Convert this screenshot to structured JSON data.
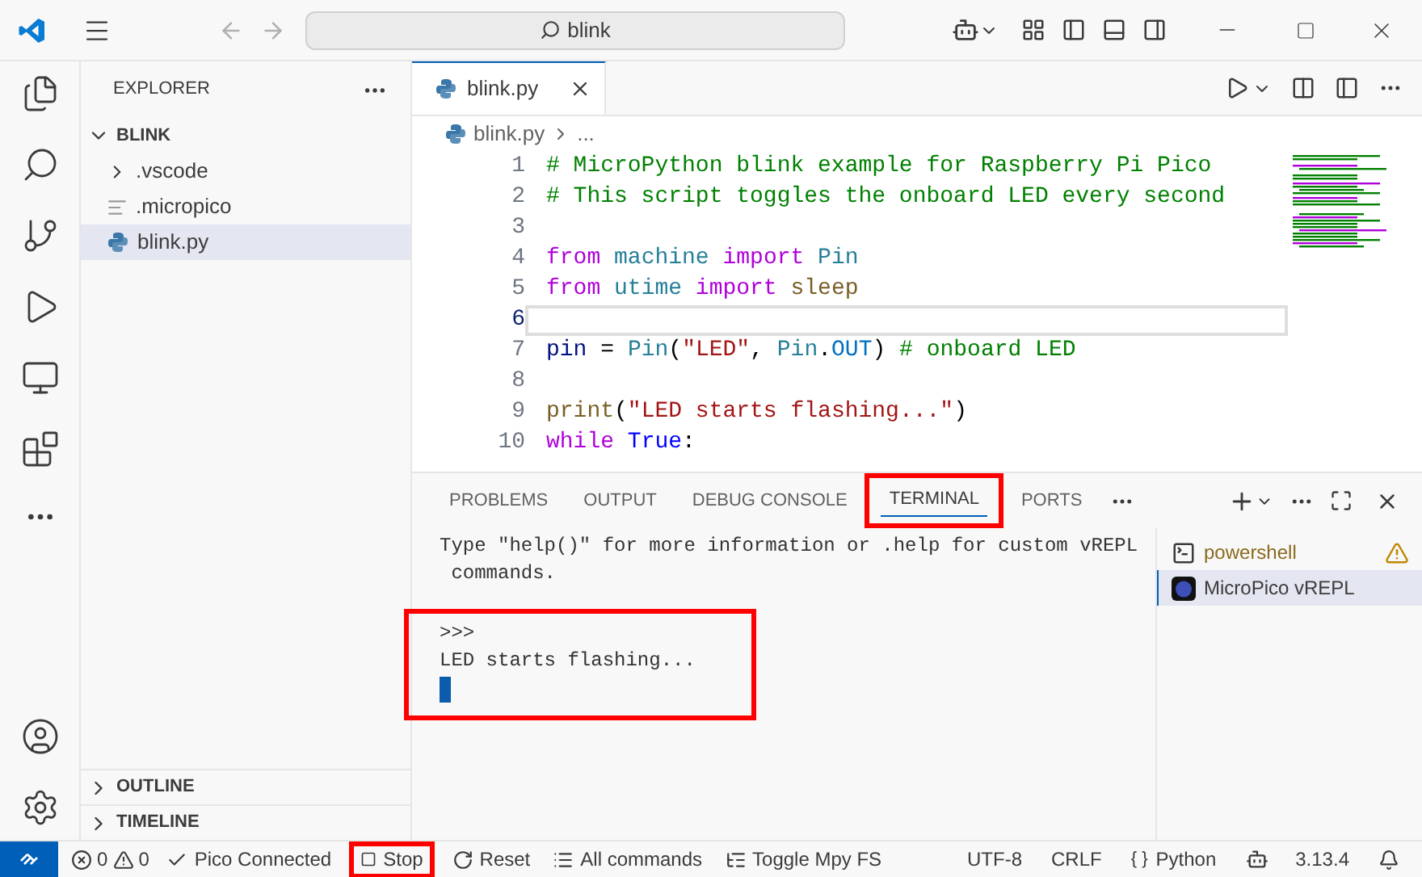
{
  "titlebar": {
    "search": "blink"
  },
  "sidebar": {
    "title": "EXPLORER",
    "folder": {
      "label": "BLINK",
      "expanded": true
    },
    "items": [
      {
        "label": ".vscode",
        "kind": "folder",
        "selected": false
      },
      {
        "label": ".micropico",
        "kind": "file",
        "selected": false
      },
      {
        "label": "blink.py",
        "kind": "python",
        "selected": true
      }
    ],
    "sections": [
      {
        "label": "OUTLINE",
        "expanded": false
      },
      {
        "label": "TIMELINE",
        "expanded": false
      }
    ]
  },
  "editor": {
    "tab": "blink.py",
    "breadcrumb": [
      "blink.py",
      "..."
    ],
    "lines": [
      {
        "number": "1",
        "current": false,
        "tokens": [
          {
            "t": "# MicroPython blink example for Raspberry Pi Pico",
            "kind": "comment"
          }
        ]
      },
      {
        "number": "2",
        "current": false,
        "tokens": [
          {
            "t": "# This script toggles the onboard LED every second",
            "kind": "comment"
          }
        ]
      },
      {
        "number": "3",
        "current": false
      },
      {
        "number": "4",
        "current": false,
        "tokens": [
          {
            "t": "from",
            "kind": "keyword"
          },
          {
            "t": " machine ",
            "kind": "type"
          },
          {
            "t": "import",
            "kind": "keyword"
          },
          {
            "t": " Pin",
            "kind": "type"
          }
        ]
      },
      {
        "number": "5",
        "current": false,
        "tokens": [
          {
            "t": "from",
            "kind": "keyword"
          },
          {
            "t": " utime ",
            "kind": "type"
          },
          {
            "t": "import",
            "kind": "keyword"
          },
          {
            "t": " sleep",
            "kind": "function"
          }
        ]
      },
      {
        "number": "6",
        "current": true
      },
      {
        "number": "7",
        "current": false,
        "tokens": [
          {
            "t": "pin",
            "kind": "variable"
          },
          {
            "t": " = ",
            "kind": "plain"
          },
          {
            "t": "Pin",
            "kind": "type"
          },
          {
            "t": "(",
            "kind": "plain"
          },
          {
            "t": "\"LED\"",
            "kind": "string"
          },
          {
            "t": ", ",
            "kind": "plain"
          },
          {
            "t": "Pin",
            "kind": "type"
          },
          {
            "t": ".",
            "kind": "plain"
          },
          {
            "t": "OUT",
            "kind": "constant"
          },
          {
            "t": ") ",
            "kind": "plain"
          },
          {
            "t": "# onboard LED",
            "kind": "comment"
          }
        ]
      },
      {
        "number": "8",
        "current": false
      },
      {
        "number": "9",
        "current": false,
        "tokens": [
          {
            "t": "print",
            "kind": "function"
          },
          {
            "t": "(",
            "kind": "plain"
          },
          {
            "t": "\"LED starts flashing...\"",
            "kind": "string"
          },
          {
            "t": ")",
            "kind": "plain"
          }
        ]
      },
      {
        "number": "10",
        "current": false,
        "tokens": [
          {
            "t": "while",
            "kind": "keyword"
          },
          {
            "t": " True",
            "kind": "literal"
          },
          {
            "t": ":",
            "kind": "plain"
          }
        ]
      }
    ]
  },
  "panel": {
    "tabs": [
      {
        "label": "PROBLEMS",
        "selected": false,
        "highlighted": false
      },
      {
        "label": "OUTPUT",
        "selected": false,
        "highlighted": false
      },
      {
        "label": "DEBUG CONSOLE",
        "selected": false,
        "highlighted": false
      },
      {
        "label": "TERMINAL",
        "selected": true,
        "highlighted": true
      },
      {
        "label": "PORTS",
        "selected": false,
        "highlighted": false
      }
    ],
    "terminal": {
      "intro": [
        "Type \"help()\" for more information or .help for custom vREPL",
        " commands."
      ],
      "output": [
        ">>>",
        "LED starts flashing..."
      ],
      "output_highlighted": true
    },
    "terminals": [
      {
        "label": "powershell",
        "kind": "shell",
        "selected": false,
        "warning": true
      },
      {
        "label": "MicroPico vREPL",
        "kind": "pico",
        "selected": true,
        "warning": false
      }
    ]
  },
  "status_bar": {
    "problems": {
      "errors": "0",
      "warnings": "0"
    },
    "items": [
      {
        "label": "Pico Connected",
        "kind": "check",
        "highlighted": false
      },
      {
        "label": "Stop",
        "kind": "stop",
        "highlighted": true
      },
      {
        "label": "Reset",
        "kind": "reset",
        "highlighted": false
      },
      {
        "label": "All commands",
        "kind": "list",
        "highlighted": false
      },
      {
        "label": "Toggle Mpy FS",
        "kind": "tree",
        "highlighted": false
      }
    ],
    "right": [
      {
        "label": "UTF-8",
        "kind": "text"
      },
      {
        "label": "CRLF",
        "kind": "text"
      },
      {
        "label": "Python",
        "kind": "braces",
        "icon": "{ }"
      },
      {
        "label": "3.13.4",
        "kind": "copilot"
      }
    ]
  }
}
